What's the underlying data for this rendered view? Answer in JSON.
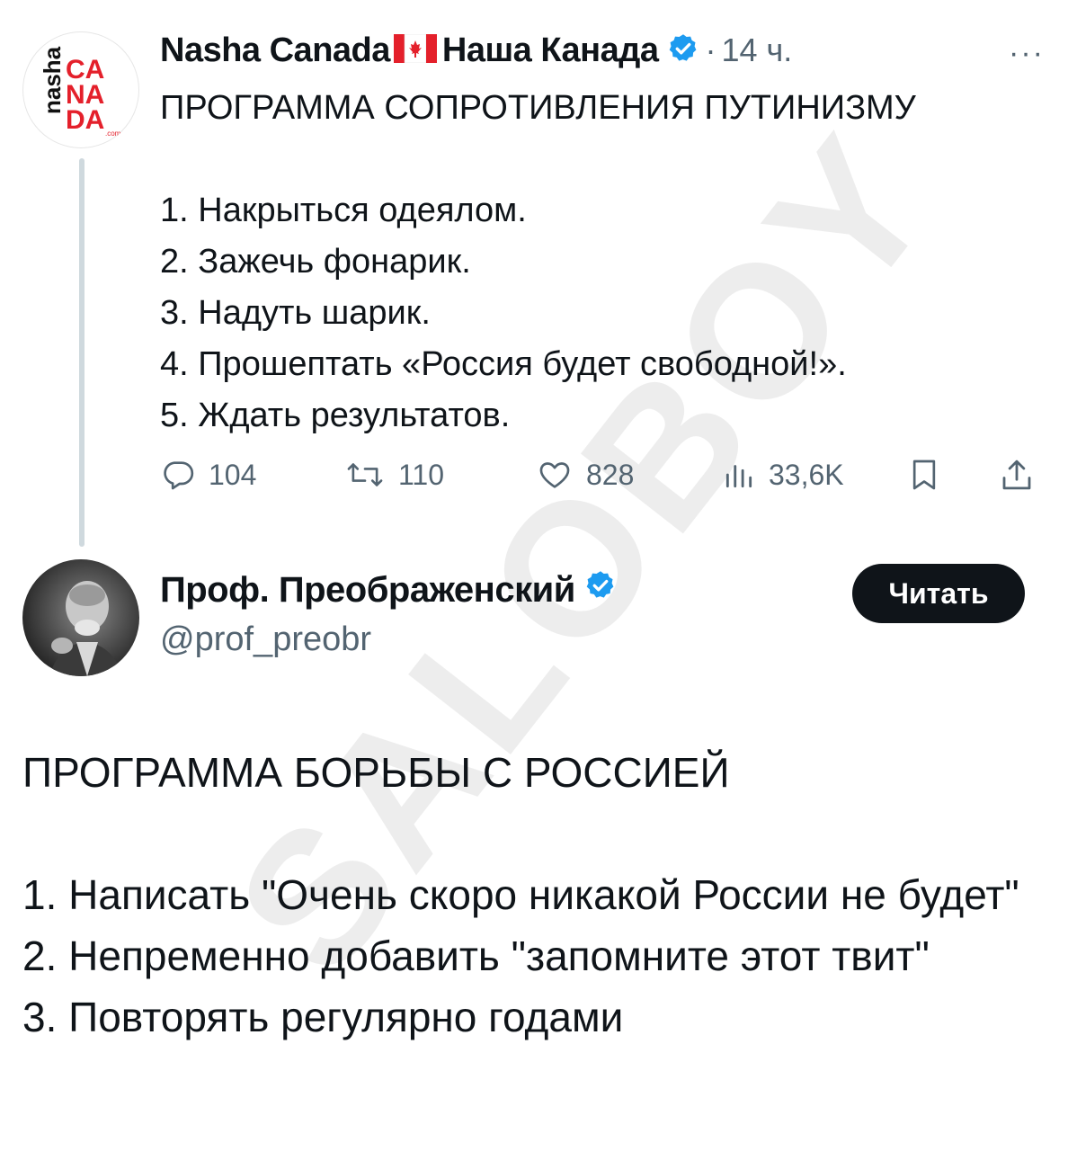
{
  "tweet1": {
    "avatar_text": {
      "line1": "nasha",
      "line2": "CA",
      "line3": "NA",
      "line4": "DA",
      "small": ".com"
    },
    "author_name": "Nasha Canada",
    "author_name_ru": "Наша Канада",
    "separator": "·",
    "time": "14 ч.",
    "more_label": "···",
    "lines": [
      "ПРОГРАММА СОПРОТИВЛЕНИЯ ПУТИНИЗМУ",
      "",
      "1. Накрыться одеялом.",
      "2. Зажечь фонарик.",
      "3. Надуть шарик.",
      "4. Прошептать «Россия будет свободной!».",
      "5. Ждать результатов."
    ],
    "actions": {
      "replies": "104",
      "reposts": "110",
      "likes": "828",
      "views": "33,6K"
    }
  },
  "tweet2": {
    "author_name": "Проф. Преображенский",
    "handle": "@prof_preobr",
    "follow_label": "Читать",
    "lines": [
      "ПРОГРАММА БОРЬБЫ С РОССИЕЙ",
      "",
      "1. Написать \"Очень скоро никакой России не будет\"",
      "2. Непременно добавить \"запомните этот твит\"",
      "3. Повторять регулярно годами"
    ]
  },
  "watermark": "SALOBOY",
  "colors": {
    "text": "#0f1419",
    "secondary": "#536471",
    "verified": "#1d9bf0",
    "brand_red": "#e4202b"
  }
}
